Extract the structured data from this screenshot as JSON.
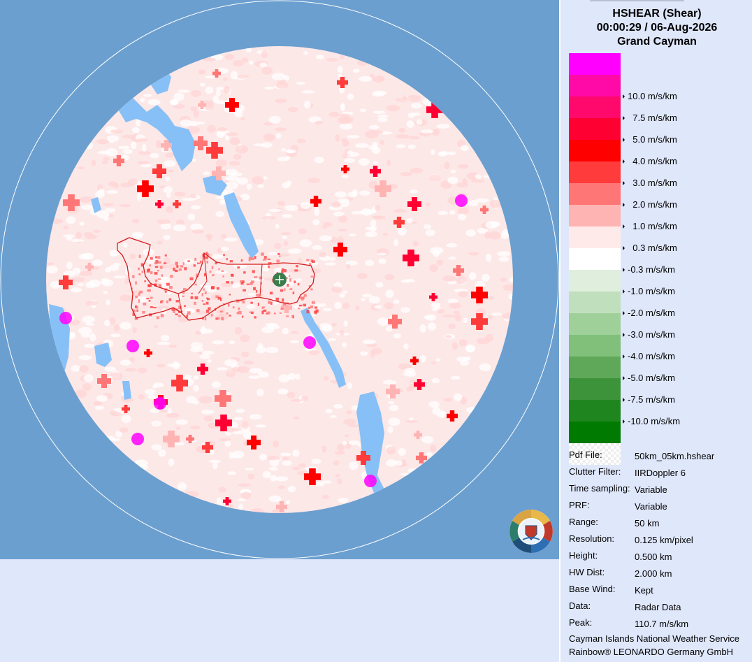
{
  "header": {
    "product": "HSHEAR (Shear)",
    "datetime": "00:00:29 / 06-Aug-2026",
    "site": "Grand Cayman"
  },
  "legend": {
    "entries": [
      {
        "color": "#ff00ff",
        "label": ""
      },
      {
        "color": "#ff0aa6",
        "label": "10.0 m/s/km"
      },
      {
        "color": "#ff0a6c",
        "label": "  7.5 m/s/km"
      },
      {
        "color": "#ff0033",
        "label": "  5.0 m/s/km"
      },
      {
        "color": "#ff0000",
        "label": "  4.0 m/s/km"
      },
      {
        "color": "#ff3b3b",
        "label": "  3.0 m/s/km"
      },
      {
        "color": "#ff7676",
        "label": "  2.0 m/s/km"
      },
      {
        "color": "#ffb4b4",
        "label": "  1.0 m/s/km"
      },
      {
        "color": "#ffeaea",
        "label": "  0.3 m/s/km"
      },
      {
        "color": "#ffffff",
        "label": "-0.3 m/s/km"
      },
      {
        "color": "#dfeedd",
        "label": "-1.0 m/s/km"
      },
      {
        "color": "#c0e0bd",
        "label": "-2.0 m/s/km"
      },
      {
        "color": "#a0d09a",
        "label": "-3.0 m/s/km"
      },
      {
        "color": "#80c07a",
        "label": "-4.0 m/s/km"
      },
      {
        "color": "#5fa85a",
        "label": "-5.0 m/s/km"
      },
      {
        "color": "#3c933a",
        "label": "-7.5 m/s/km"
      },
      {
        "color": "#1f861f",
        "label": "-10.0 m/s/km"
      },
      {
        "color": "#007a00",
        "label": ""
      },
      {
        "color": "checker",
        "label": ""
      }
    ]
  },
  "info": [
    {
      "key": "Pdf File:",
      "value": "50km_05km.hshear"
    },
    {
      "key": "Clutter Filter:",
      "value": "IIRDoppler 6"
    },
    {
      "key": "Time sampling:",
      "value": "Variable"
    },
    {
      "key": "PRF:",
      "value": "Variable"
    },
    {
      "key": "Range:",
      "value": "50 km"
    },
    {
      "key": "Resolution:",
      "value": "0.125 km/pixel"
    },
    {
      "key": "Height:",
      "value": "0.500 km"
    },
    {
      "key": "HW Dist:",
      "value": "2.000 km"
    },
    {
      "key": "Base Wind:",
      "value": "Kept"
    },
    {
      "key": "Data:",
      "value": "Radar Data"
    },
    {
      "key": "Peak:",
      "value": "110.7 m/s/km"
    }
  ],
  "credits": {
    "line1": "Cayman Islands National Weather Service",
    "line2": "Rainbow® LEONARDO Germany GmbH"
  },
  "colors": {
    "background_outside": "#6b9fcf",
    "panel": "#dfe7fb",
    "radar_base": "#fde8e8",
    "no_data": "#87c0f6",
    "coastline": "#d41c1c",
    "radar_site": "#3c7c4c"
  },
  "icons": {
    "radar_site": "crosshair-icon",
    "logo": "cayman-islands-nws-logo"
  }
}
